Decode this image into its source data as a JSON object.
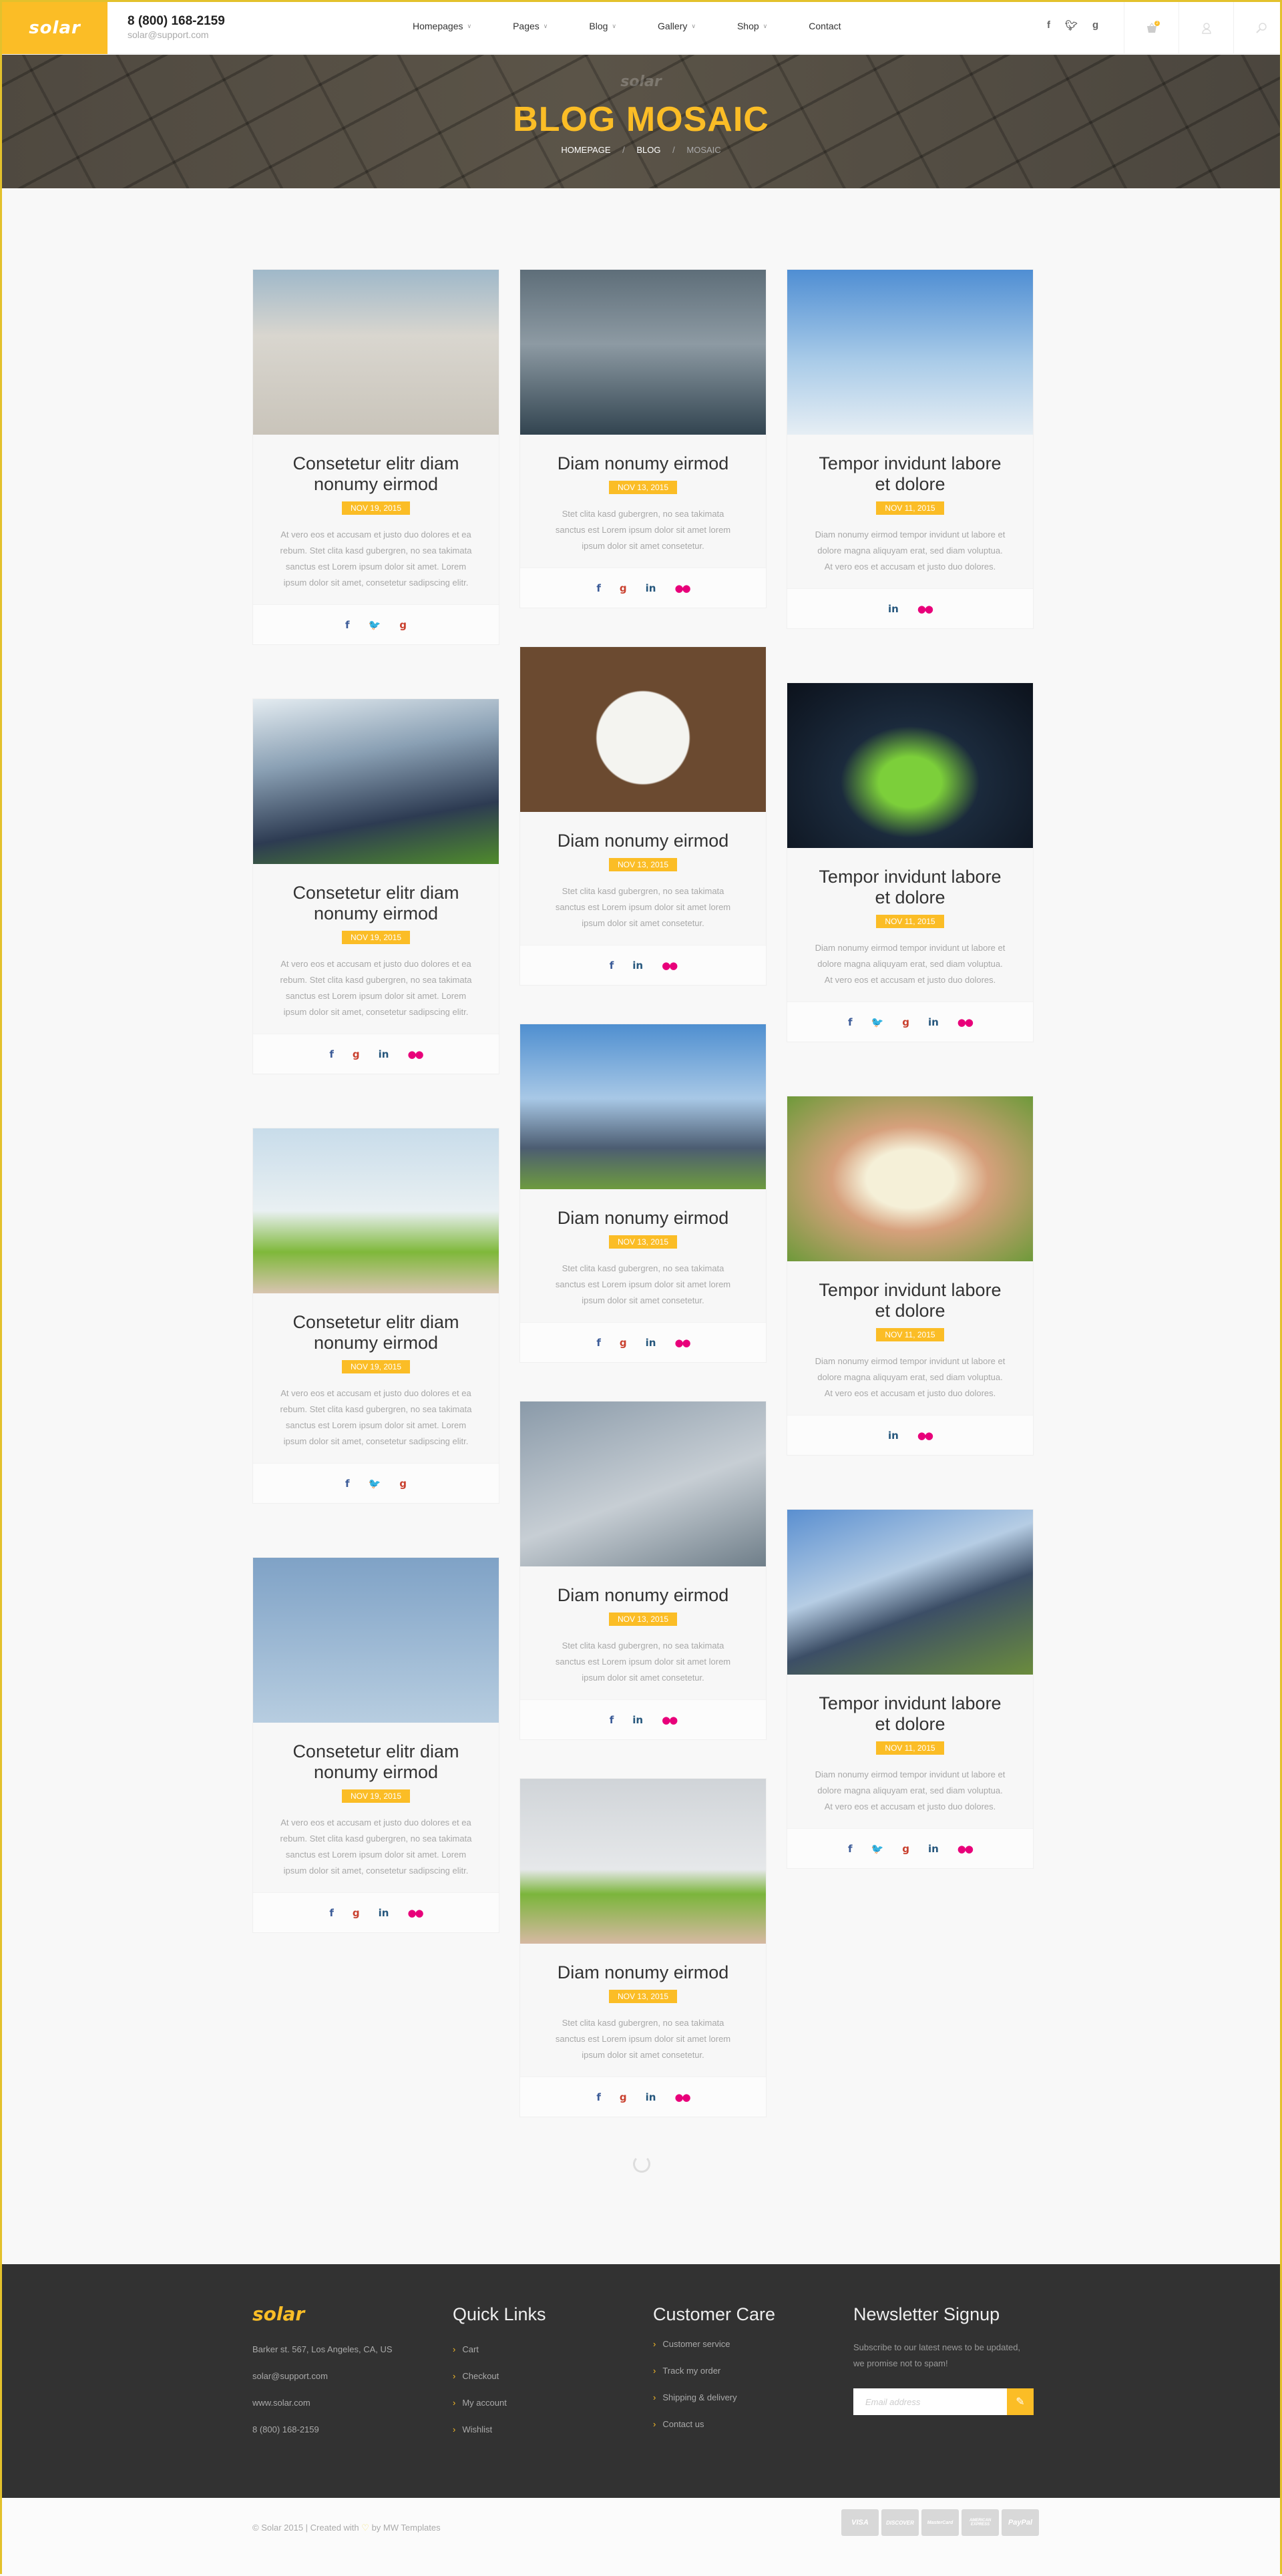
{
  "header": {
    "logo": "solar",
    "phone": "8 (800) 168-2159",
    "email": "solar@support.com",
    "nav": [
      {
        "label": "Homepages",
        "dropdown": true
      },
      {
        "label": "Pages",
        "dropdown": true
      },
      {
        "label": "Blog",
        "dropdown": true
      },
      {
        "label": "Gallery",
        "dropdown": true
      },
      {
        "label": "Shop",
        "dropdown": true
      },
      {
        "label": "Contact",
        "dropdown": false
      }
    ],
    "social": [
      {
        "name": "facebook",
        "glyph": "f"
      },
      {
        "name": "twitter",
        "glyph": "t"
      },
      {
        "name": "google",
        "glyph": "g"
      }
    ],
    "cart_count": "2",
    "icons": {
      "cart": "basket-icon",
      "account": "user-icon",
      "search": "search-icon"
    }
  },
  "hero": {
    "logo": "solar",
    "title": "BLOG MOSAIC",
    "breadcrumb": [
      "HOMEPAGE",
      "BLOG",
      "MOSAIC"
    ]
  },
  "posts": {
    "col1": [
      {
        "title": "Consetetur elitr diam nonumy eirmod",
        "date": "NOV 19, 2015",
        "excerpt": "At vero eos et accusam et justo duo dolores et ea rebum. Stet clita kasd gubergren, no sea takimata sanctus est Lorem ipsum dolor sit amet. Lorem ipsum dolor sit amet, consetetur sadipscing elitr.",
        "image": "wind-turbine-clouds",
        "social": [
          "facebook",
          "twitter",
          "google"
        ]
      },
      {
        "title": "Consetetur elitr diam nonumy eirmod",
        "date": "NOV 19, 2015",
        "excerpt": "At vero eos et accusam et justo duo dolores et ea rebum. Stet clita kasd gubergren, no sea takimata sanctus est Lorem ipsum dolor sit amet. Lorem ipsum dolor sit amet, consetetur sadipscing elitr.",
        "image": "solar-panels-turbines",
        "social": [
          "facebook",
          "google",
          "linkedin",
          "flickr"
        ]
      },
      {
        "title": "Consetetur elitr diam nonumy eirmod",
        "date": "NOV 19, 2015",
        "excerpt": "At vero eos et accusam et justo duo dolores et ea rebum. Stet clita kasd gubergren, no sea takimata sanctus est Lorem ipsum dolor sit amet. Lorem ipsum dolor sit amet, consetetur sadipscing elitr.",
        "image": "hand-holding-house",
        "social": [
          "facebook",
          "twitter",
          "google"
        ]
      },
      {
        "title": "Consetetur elitr diam nonumy eirmod",
        "date": "NOV 19, 2015",
        "excerpt": "At vero eos et accusam et justo duo dolores et ea rebum. Stet clita kasd gubergren, no sea takimata sanctus est Lorem ipsum dolor sit amet. Lorem ipsum dolor sit amet, consetetur sadipscing elitr.",
        "image": "union-jack-turbine",
        "social": [
          "facebook",
          "google",
          "linkedin",
          "flickr"
        ]
      }
    ],
    "col2": [
      {
        "title": "Diam nonumy eirmod",
        "date": "NOV 13, 2015",
        "excerpt": "Stet clita kasd gubergren, no sea takimata sanctus est Lorem ipsum dolor sit amet lorem ipsum dolor sit amet consetetur.",
        "image": "offshore-turbines",
        "social": [
          "facebook",
          "google",
          "linkedin",
          "flickr"
        ]
      },
      {
        "title": "Diam nonumy eirmod",
        "date": "NOV 13, 2015",
        "excerpt": "Stet clita kasd gubergren, no sea takimata sanctus est Lorem ipsum dolor sit amet lorem ipsum dolor sit amet consetetur.",
        "image": "recycle-blueprints",
        "social": [
          "facebook",
          "linkedin",
          "flickr"
        ]
      },
      {
        "title": "Diam nonumy eirmod",
        "date": "NOV 13, 2015",
        "excerpt": "Stet clita kasd gubergren, no sea takimata sanctus est Lorem ipsum dolor sit amet lorem ipsum dolor sit amet consetetur.",
        "image": "engineer-solar-field",
        "social": [
          "facebook",
          "google",
          "linkedin",
          "flickr"
        ]
      },
      {
        "title": "Diam nonumy eirmod",
        "date": "NOV 13, 2015",
        "excerpt": "Stet clita kasd gubergren, no sea takimata sanctus est Lorem ipsum dolor sit amet lorem ipsum dolor sit amet consetetur.",
        "image": "turbine-closeup",
        "social": [
          "facebook",
          "linkedin",
          "flickr"
        ]
      },
      {
        "title": "Diam nonumy eirmod",
        "date": "NOV 13, 2015",
        "excerpt": "Stet clita kasd gubergren, no sea takimata sanctus est Lorem ipsum dolor sit amet lorem ipsum dolor sit amet consetetur.",
        "image": "hand-turbines-grass",
        "social": [
          "facebook",
          "google",
          "linkedin",
          "flickr"
        ]
      }
    ],
    "col3": [
      {
        "title": "Tempor invidunt labore et dolore",
        "date": "NOV 11, 2015",
        "excerpt": "Diam nonumy eirmod tempor invidunt ut labore et dolore magna aliquyam erat, sed diam voluptua. At vero eos et accusam et justo duo dolores.",
        "image": "turbine-farm-sky",
        "social": [
          "linkedin",
          "flickr"
        ]
      },
      {
        "title": "Tempor invidunt labore et dolore",
        "date": "NOV 11, 2015",
        "excerpt": "Diam nonumy eirmod tempor invidunt ut labore et dolore magna aliquyam erat, sed diam voluptua. At vero eos et accusam et justo duo dolores.",
        "image": "hands-green-island",
        "social": [
          "facebook",
          "twitter",
          "google",
          "linkedin",
          "flickr"
        ]
      },
      {
        "title": "Tempor invidunt labore et dolore",
        "date": "NOV 11, 2015",
        "excerpt": "Diam nonumy eirmod tempor invidunt ut labore et dolore magna aliquyam erat, sed diam voluptua. At vero eos et accusam et justo duo dolores.",
        "image": "cupped-hands-turbines",
        "social": [
          "linkedin",
          "flickr"
        ]
      },
      {
        "title": "Tempor invidunt labore et dolore",
        "date": "NOV 11, 2015",
        "excerpt": "Diam nonumy eirmod tempor invidunt ut labore et dolore magna aliquyam erat, sed diam voluptua. At vero eos et accusam et justo duo dolores.",
        "image": "solar-panel-turbine",
        "social": [
          "facebook",
          "twitter",
          "google",
          "linkedin",
          "flickr"
        ]
      }
    ]
  },
  "social_glyphs": {
    "facebook": "f",
    "twitter": "🐦",
    "google": "g",
    "linkedin": "in",
    "flickr": "●●"
  },
  "footer": {
    "logo": "solar",
    "address": "Barker st. 567, Los Angeles, CA, US",
    "email": "solar@support.com",
    "website": "www.solar.com",
    "phone": "8 (800) 168-2159",
    "quick_links": {
      "heading": "Quick Links",
      "items": [
        "Cart",
        "Checkout",
        "My account",
        "Wishlist"
      ]
    },
    "customer_care": {
      "heading": "Customer Care",
      "items": [
        "Customer service",
        "Track my order",
        "Shipping & delivery",
        "Contact us"
      ]
    },
    "newsletter": {
      "heading": "Newsletter Signup",
      "text": "Subscribe to our latest news to be updated, we promise not to spam!",
      "placeholder": "Email address",
      "value": ""
    }
  },
  "bottom": {
    "copyright_pre": "© Solar 2015 | Created with",
    "copyright_post": "by MW Templates",
    "payments": [
      "VISA",
      "DISCOVER",
      "MasterCard",
      "AMERICAN EXPRESS",
      "PayPal"
    ]
  },
  "colors": {
    "accent": "#fbbd26",
    "footer_bg": "#323232",
    "page_bg": "#f8f8f8"
  }
}
